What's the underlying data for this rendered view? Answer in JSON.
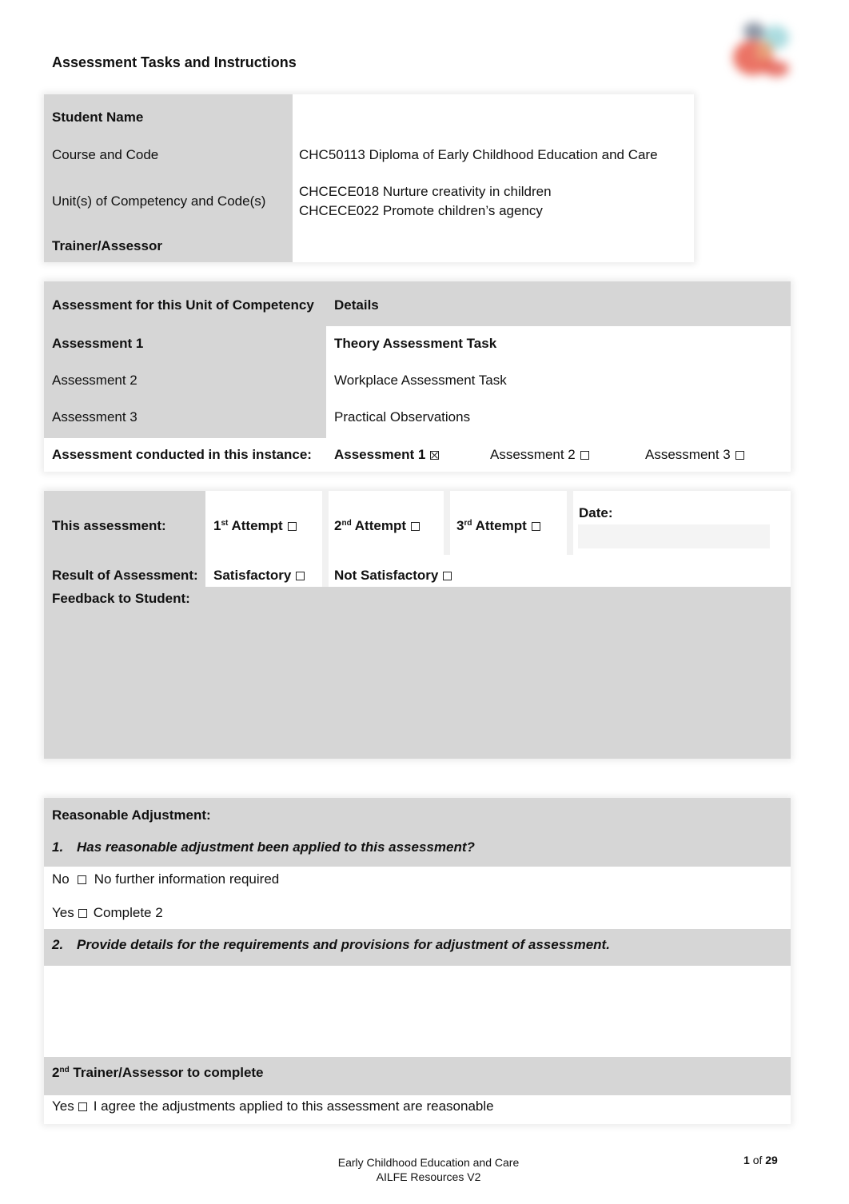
{
  "page": {
    "title": "Assessment Tasks and Instructions",
    "logo": "organisation-logo"
  },
  "student_info": {
    "student_name_label": "Student Name",
    "student_name_value": "",
    "course_label": "Course and Code",
    "course_value": "CHC50113 Diploma of Early Childhood Education and Care",
    "units_label": "Unit(s) of Competency and Code(s)",
    "units_values": [
      "CHCECE018 Nurture creativity in children",
      "CHCECE022 Promote children’s agency"
    ],
    "trainer_label": "Trainer/Assessor",
    "trainer_value": ""
  },
  "assessments": {
    "header_col1": "Assessment for this Unit of Competency",
    "header_col2": "Details",
    "rows": [
      {
        "name": "Assessment 1",
        "detail": "Theory Assessment Task",
        "bold": true
      },
      {
        "name": "Assessment 2",
        "detail": "Workplace Assessment Task",
        "bold": false
      },
      {
        "name": "Assessment 3",
        "detail": "Practical Observations",
        "bold": false
      }
    ],
    "conducted_label": "Assessment conducted in this instance:",
    "conducted_options": [
      {
        "label": "Assessment 1",
        "checked": true
      },
      {
        "label": "Assessment 2",
        "checked": false
      },
      {
        "label": "Assessment 3",
        "checked": false
      }
    ]
  },
  "attempt": {
    "label": "This assessment:",
    "options": [
      {
        "num": "1",
        "sup": "st",
        "label": "Attempt",
        "checked": false
      },
      {
        "num": "2",
        "sup": "nd",
        "label": "Attempt",
        "checked": false
      },
      {
        "num": "3",
        "sup": "rd",
        "label": "Attempt",
        "checked": false
      }
    ],
    "date_label": "Date:",
    "date_value": "",
    "result_label": "Result of Assessment:",
    "result_options": [
      {
        "label": "Satisfactory",
        "checked": false
      },
      {
        "label": "Not Satisfactory",
        "checked": false
      }
    ],
    "feedback_label": "Feedback to Student:",
    "feedback_value": ""
  },
  "adjustment": {
    "heading": "Reasonable Adjustment:",
    "q1_num": "1.",
    "q1": "Has reasonable adjustment been applied to this assessment?",
    "no_label": "No",
    "no_text": "No further information required",
    "no_checked": false,
    "yes_label": "Yes",
    "yes_text": "Complete 2",
    "yes_checked": false,
    "q2_num": "2.",
    "q2": "Provide details for the requirements and provisions for adjustment of assessment.",
    "details_value": "",
    "second_assessor_num": "2",
    "second_assessor_sup": "nd",
    "second_assessor_heading": "Trainer/Assessor to complete",
    "agree_label": "Yes",
    "agree_text": "I agree the adjustments applied to this assessment are reasonable",
    "agree_checked": false
  },
  "footer": {
    "line1": "Early Childhood Education and Care",
    "line2": "AILFE Resources V2",
    "page_current": "1",
    "page_of": "of",
    "page_total": "29"
  }
}
